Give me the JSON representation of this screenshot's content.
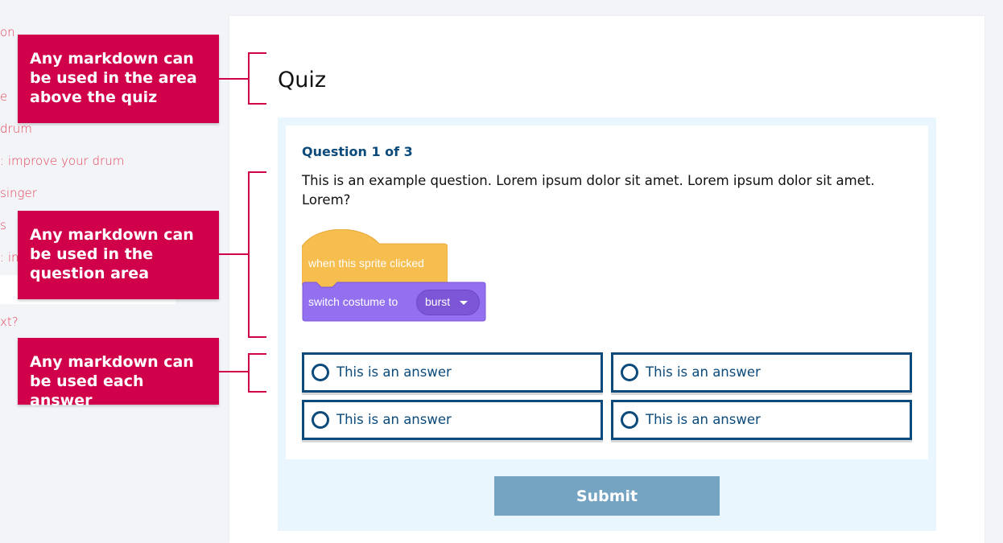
{
  "sidebar": {
    "items": [
      {
        "label": "on"
      },
      {
        "label": "e"
      },
      {
        "label": "drum"
      },
      {
        "label": ": improve your drum"
      },
      {
        "label": "singer"
      },
      {
        "label": "s"
      },
      {
        "label": ": im"
      },
      {
        "label": "xt?"
      }
    ]
  },
  "quiz": {
    "title": "Quiz",
    "question_count": "Question 1 of 3",
    "question_text": "This is an example question. Lorem ipsum dolor sit amet. Lorem ipsum dolor sit amet. Lorem?",
    "blocks": {
      "hat_label": "when this sprite clicked",
      "looks_label": "switch costume to",
      "dropdown_value": "burst"
    },
    "answers": [
      {
        "label": "This is an answer"
      },
      {
        "label": "This is an answer"
      },
      {
        "label": "This is an answer"
      },
      {
        "label": "This is an answer"
      }
    ],
    "submit_label": "Submit"
  },
  "callouts": [
    {
      "text": "Any markdown can be used in the area above the quiz"
    },
    {
      "text": "Any markdown can be used in the question area"
    },
    {
      "text": "Any markdown can be used each answer"
    }
  ],
  "colors": {
    "accent": "#d1004a",
    "primary": "#0b4a7a",
    "submit": "#75a3c2",
    "quiz_background": "#eaf6fd",
    "events_block": "#f5be4f",
    "looks_block": "#9370f0"
  }
}
